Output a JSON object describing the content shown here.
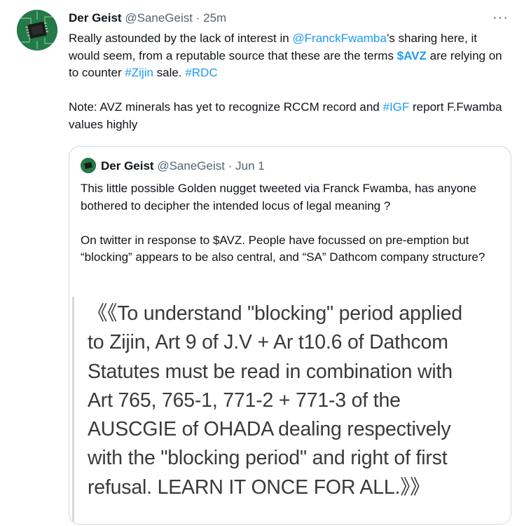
{
  "tweet": {
    "author_name": "Der Geist",
    "author_handle": "@SaneGeist",
    "separator": "·",
    "time": "25m",
    "more_label": "···",
    "text": {
      "part1": "Really astounded by the lack of interest in ",
      "mention": "@FranckFwamba",
      "part2": "’s sharing here, it would seem, from a reputable source that these are the terms ",
      "cashtag": "$AVZ",
      "part3": " are relying on to counter ",
      "hashtag1": "#Zijin",
      "part4": " sale. ",
      "hashtag2": "#RDC",
      "note_part1": "Note: AVZ minerals has yet to recognize RCCM record and ",
      "hashtag3": "#IGF",
      "note_part2": " report F.Fwamba values highly"
    }
  },
  "quote": {
    "author_name": "Der Geist",
    "author_handle": "@SaneGeist",
    "separator": "·",
    "date": "Jun 1",
    "para1": "This little possible Golden nugget tweeted via Franck Fwamba, has anyone bothered to decipher the intended locus of legal meaning ?",
    "para2": "On twitter in response to $AVZ. People have focussed on pre-emption but “blocking” appears to be also central, and “SA” Dathcom company structure?",
    "image_lines": [
      "《《To understand \"blocking\" period applied",
      "to Zijin, Art 9 of J.V + Ar t10.6 of Dathcom",
      "Statutes must be read in combination with",
      "Art 765, 765-1, 771-2 + 771-3 of the",
      "AUSCGIE of OHADA dealing respectively",
      "with the \"blocking period\" and right of first",
      "refusal. LEARN IT ONCE FOR ALL.》》"
    ]
  }
}
